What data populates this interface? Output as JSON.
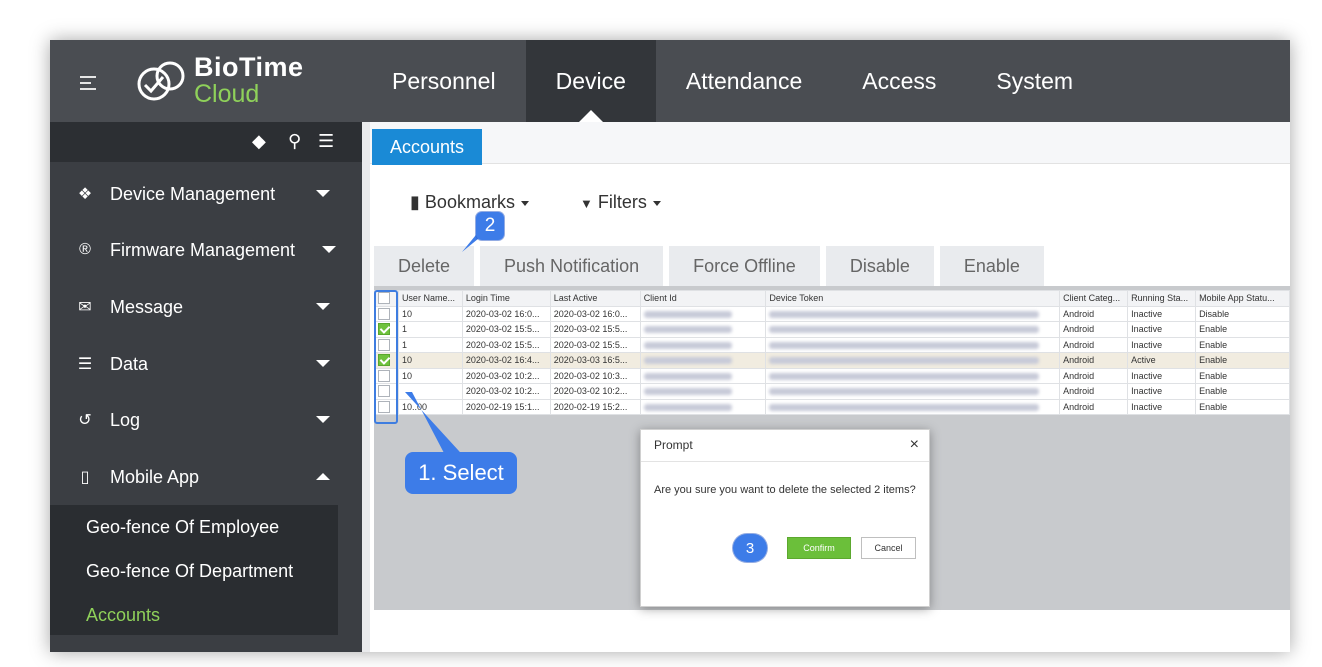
{
  "brand": {
    "line1": "BioTime",
    "line2": "Cloud",
    "accent": "#8fd15a"
  },
  "nav": [
    {
      "label": "Personnel"
    },
    {
      "label": "Device"
    },
    {
      "label": "Attendance"
    },
    {
      "label": "Access"
    },
    {
      "label": "System"
    }
  ],
  "sidebar": {
    "items": [
      {
        "icon": "cubes-icon",
        "label": "Device Management"
      },
      {
        "icon": "registered-icon",
        "label": "Firmware Management"
      },
      {
        "icon": "chat-icon",
        "label": "Message"
      },
      {
        "icon": "database-icon",
        "label": "Data"
      },
      {
        "icon": "history-icon",
        "label": "Log"
      },
      {
        "icon": "mobile-icon",
        "label": "Mobile App"
      }
    ],
    "subitems": [
      {
        "label": "Geo-fence Of Employee"
      },
      {
        "label": "Geo-fence Of Department"
      },
      {
        "label": "Accounts"
      }
    ]
  },
  "tab": {
    "label": "Accounts"
  },
  "toolbar": {
    "bookmarks": "Bookmarks",
    "filters": "Filters"
  },
  "actions": [
    "Delete",
    "Push Notification",
    "Force Offline",
    "Disable",
    "Enable"
  ],
  "grid": {
    "headers": [
      "User Name...",
      "Login Time",
      "Last Active",
      "Client Id",
      "Device Token",
      "Client Categ...",
      "Running Sta...",
      "Mobile App Statu..."
    ],
    "rows": [
      {
        "checked": false,
        "user": "10",
        "login": "2020-03-02 16:0...",
        "last": "2020-03-02 16:0...",
        "category": "Android",
        "running": "Inactive",
        "status": "Disable"
      },
      {
        "checked": true,
        "user": "1",
        "login": "2020-03-02 15:5...",
        "last": "2020-03-02 15:5...",
        "category": "Android",
        "running": "Inactive",
        "status": "Enable"
      },
      {
        "checked": false,
        "user": "1",
        "login": "2020-03-02 15:5...",
        "last": "2020-03-02 15:5...",
        "category": "Android",
        "running": "Inactive",
        "status": "Enable"
      },
      {
        "checked": true,
        "user": "10",
        "login": "2020-03-02 16:4...",
        "last": "2020-03-03 16:5...",
        "category": "Android",
        "running": "Active",
        "status": "Enable"
      },
      {
        "checked": false,
        "user": "10",
        "login": "2020-03-02 10:2...",
        "last": "2020-03-02 10:3...",
        "category": "Android",
        "running": "Inactive",
        "status": "Enable"
      },
      {
        "checked": false,
        "user": "",
        "login": "2020-03-02 10:2...",
        "last": "2020-03-02 10:2...",
        "category": "Android",
        "running": "Inactive",
        "status": "Enable"
      },
      {
        "checked": false,
        "user": "10..00",
        "login": "2020-02-19 15:1...",
        "last": "2020-02-19 15:2...",
        "category": "Android",
        "running": "Inactive",
        "status": "Enable"
      }
    ]
  },
  "dialog": {
    "title": "Prompt",
    "close": "×",
    "message": "Are you sure you want to delete the selected 2 items?",
    "confirm": "Confirm",
    "cancel": "Cancel"
  },
  "annotations": {
    "step1": "1. Select",
    "step2": "2",
    "step3": "3"
  }
}
